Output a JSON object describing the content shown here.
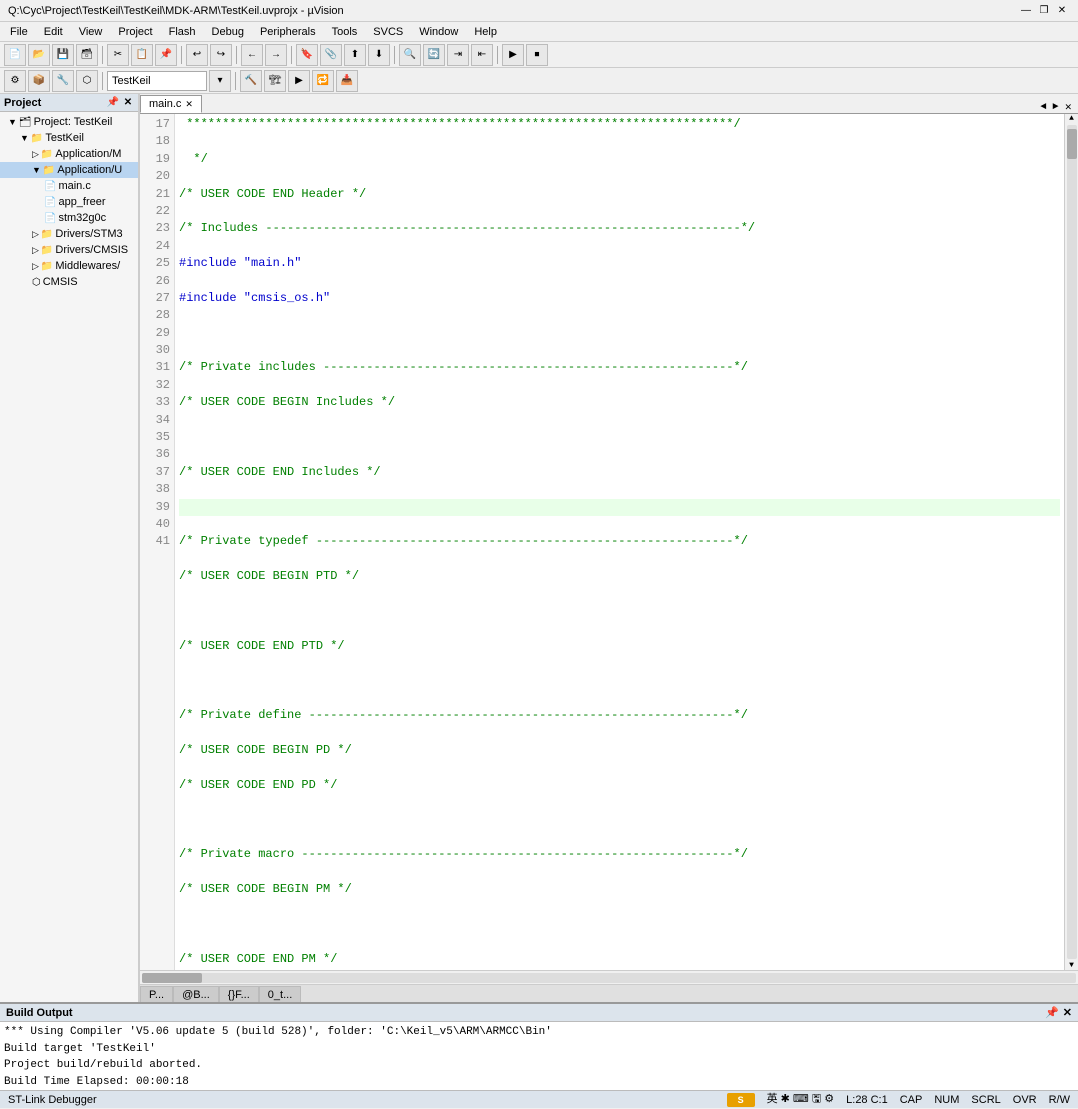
{
  "titlebar": {
    "title": "Q:\\Cyc\\Project\\TestKeil\\TestKeil\\MDK-ARM\\TestKeil.uvprojx - µVision",
    "minimize": "—",
    "maximize": "❐",
    "close": "✕"
  },
  "menubar": {
    "items": [
      "File",
      "Edit",
      "View",
      "Project",
      "Flash",
      "Debug",
      "Peripherals",
      "Tools",
      "SVCS",
      "Window",
      "Help"
    ]
  },
  "toolbar1": {
    "project_name": "TestKeil"
  },
  "project_pane": {
    "title": "Project",
    "tree": [
      {
        "level": 1,
        "icon": "▷",
        "label": "Project: TestKeil",
        "toggle": "▼"
      },
      {
        "level": 2,
        "icon": "▷",
        "label": "TestKeil",
        "toggle": "▼"
      },
      {
        "level": 3,
        "icon": "📁",
        "label": "Application/M",
        "toggle": "▷"
      },
      {
        "level": 3,
        "icon": "📁",
        "label": "Application/U",
        "toggle": "▷",
        "selected": true
      },
      {
        "level": 4,
        "icon": "📄",
        "label": "main.c"
      },
      {
        "level": 4,
        "icon": "📄",
        "label": "app_freer"
      },
      {
        "level": 4,
        "icon": "📄",
        "label": "stm32g0c"
      },
      {
        "level": 3,
        "icon": "📁",
        "label": "Drivers/STM3",
        "toggle": "▷"
      },
      {
        "level": 3,
        "icon": "📁",
        "label": "Drivers/CMSIS",
        "toggle": "▷"
      },
      {
        "level": 3,
        "icon": "📁",
        "label": "Middlewares/",
        "toggle": "▷"
      },
      {
        "level": 3,
        "icon": "⬡",
        "label": "CMSIS"
      }
    ]
  },
  "editor": {
    "tab": "main.c",
    "lines": [
      {
        "num": 17,
        "text": " *******************************************************************",
        "highlighted": false,
        "type": "comment"
      },
      {
        "num": 18,
        "text": "  */",
        "highlighted": false,
        "type": "comment"
      },
      {
        "num": 19,
        "text": "/* USER CODE END Header */",
        "highlighted": false,
        "type": "comment"
      },
      {
        "num": 20,
        "text": "/* Includes ---------------------------------------------------------*/",
        "highlighted": false,
        "type": "comment"
      },
      {
        "num": 21,
        "text": "#include \"main.h\"",
        "highlighted": false,
        "type": "directive"
      },
      {
        "num": 22,
        "text": "#include \"cmsis_os.h\"",
        "highlighted": false,
        "type": "directive"
      },
      {
        "num": 23,
        "text": "",
        "highlighted": false,
        "type": "normal"
      },
      {
        "num": 24,
        "text": "/* Private includes --------------------------------------------------*/",
        "highlighted": false,
        "type": "comment"
      },
      {
        "num": 25,
        "text": "/* USER CODE BEGIN Includes */",
        "highlighted": false,
        "type": "comment"
      },
      {
        "num": 26,
        "text": "",
        "highlighted": false,
        "type": "normal"
      },
      {
        "num": 27,
        "text": "/* USER CODE END Includes */",
        "highlighted": false,
        "type": "comment"
      },
      {
        "num": 28,
        "text": "",
        "highlighted": true,
        "type": "normal"
      },
      {
        "num": 29,
        "text": "/* Private typedef --------------------------------------------------*/",
        "highlighted": false,
        "type": "comment"
      },
      {
        "num": 30,
        "text": "/* USER CODE BEGIN PTD */",
        "highlighted": false,
        "type": "comment"
      },
      {
        "num": 31,
        "text": "",
        "highlighted": false,
        "type": "normal"
      },
      {
        "num": 32,
        "text": "/* USER CODE END PTD */",
        "highlighted": false,
        "type": "comment"
      },
      {
        "num": 33,
        "text": "",
        "highlighted": false,
        "type": "normal"
      },
      {
        "num": 34,
        "text": "/* Private define ---------------------------------------------------*/",
        "highlighted": false,
        "type": "comment"
      },
      {
        "num": 35,
        "text": "/* USER CODE BEGIN PD */",
        "highlighted": false,
        "type": "comment"
      },
      {
        "num": 36,
        "text": "/* USER CODE END PD */",
        "highlighted": false,
        "type": "comment"
      },
      {
        "num": 37,
        "text": "",
        "highlighted": false,
        "type": "normal"
      },
      {
        "num": 38,
        "text": "/* Private macro ---------------------------------------------------*/",
        "highlighted": false,
        "type": "comment"
      },
      {
        "num": 39,
        "text": "/* USER CODE BEGIN PM */",
        "highlighted": false,
        "type": "comment"
      },
      {
        "num": 40,
        "text": "",
        "highlighted": false,
        "type": "normal"
      },
      {
        "num": 41,
        "text": "/* USER CODE END PM */",
        "highlighted": false,
        "type": "comment"
      }
    ]
  },
  "bottom_tabs": [
    {
      "label": "P...",
      "active": false
    },
    {
      "label": "@B...",
      "active": false
    },
    {
      "label": "{}F...",
      "active": false
    },
    {
      "label": "0_t...",
      "active": false
    }
  ],
  "build_output": {
    "title": "Build Output",
    "lines": [
      {
        "text": "*** Using Compiler 'V5.06 update 5 (build 528)', folder: 'C:\\Keil_v5\\ARM\\ARMCC\\Bin'",
        "type": "normal"
      },
      {
        "text": "Build target 'TestKeil'",
        "type": "normal"
      },
      {
        "text": "Project build/rebuild aborted.",
        "type": "normal"
      },
      {
        "text": "Build Time Elapsed:   00:00:18",
        "type": "normal"
      }
    ]
  },
  "statusbar": {
    "debugger": "ST-Link Debugger",
    "position": "L:28 C:1",
    "caps": "CAP",
    "num": "NUM",
    "scrl": "SCRL",
    "ovr": "OVR",
    "rw": "R/W"
  }
}
